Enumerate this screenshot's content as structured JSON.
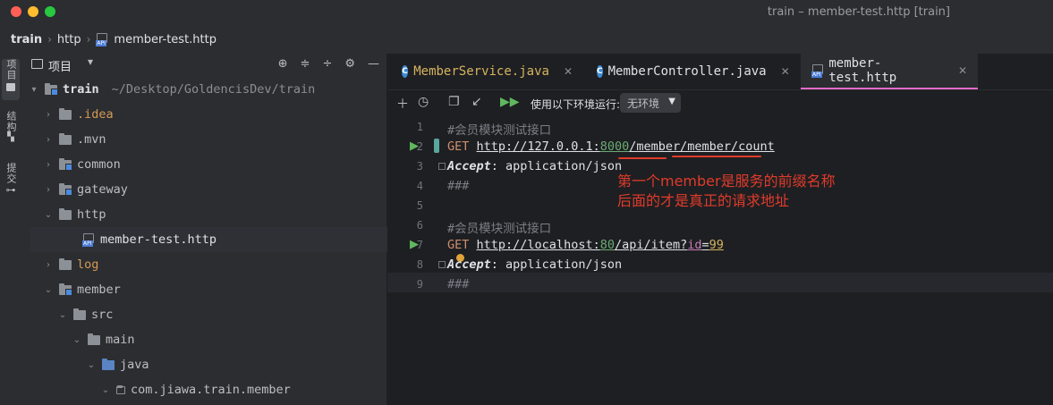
{
  "window": {
    "title": "train – member-test.http [train]"
  },
  "breadcrumb": {
    "items": [
      "train",
      "http",
      "member-test.http"
    ]
  },
  "toolstrip": {
    "items": [
      "项目",
      "结构",
      "提交"
    ]
  },
  "project": {
    "title": "项目",
    "root": {
      "name": "train",
      "path": "~/Desktop/GoldencisDev/train"
    },
    "tree": [
      {
        "label": ".idea",
        "type": "folder"
      },
      {
        "label": ".mvn",
        "type": "folder"
      },
      {
        "label": "common",
        "type": "module"
      },
      {
        "label": "gateway",
        "type": "module"
      },
      {
        "label": "http",
        "type": "folder-open"
      },
      {
        "label": "member-test.http",
        "type": "file"
      },
      {
        "label": "log",
        "type": "folder"
      },
      {
        "label": "member",
        "type": "module-open"
      },
      {
        "label": "src",
        "type": "folder-open"
      },
      {
        "label": "main",
        "type": "folder-open"
      },
      {
        "label": "java",
        "type": "src-open"
      },
      {
        "label": "com.jiawa.train.member",
        "type": "package"
      }
    ]
  },
  "tabs": [
    {
      "label": "MemberService.java"
    },
    {
      "label": "MemberController.java"
    },
    {
      "label": "member-test.http"
    }
  ],
  "toolbar": {
    "env_label": "使用以下环境运行:",
    "env_value": "无环境"
  },
  "code": {
    "line_numbers": [
      "1",
      "2",
      "3",
      "4",
      "5",
      "6",
      "7",
      "8",
      "9"
    ],
    "l1": "#会员模块测试接口",
    "l2_method": "GET",
    "l2_host": "http://127.0.0.1:",
    "l2_port": "8000",
    "l2_path": "/member/member/count",
    "l3_header": "Accept",
    "l3_sep": ": ",
    "l3_value": "application/json",
    "l4": "###",
    "l6": "#会员模块测试接口",
    "l7_method": "GET",
    "l7_host": "http://localhost:",
    "l7_port": "80",
    "l7_path": "/api/item?",
    "l7_param": "id",
    "l7_eq": "=",
    "l7_num": "99",
    "l8_header": "Accept",
    "l8_sep": ": ",
    "l8_value": "application/json",
    "l9": "###"
  },
  "annotation": {
    "line1": "第一个member是服务的前缀名称",
    "line2": "后面的才是真正的请求地址",
    "color": "#e03b2b"
  }
}
